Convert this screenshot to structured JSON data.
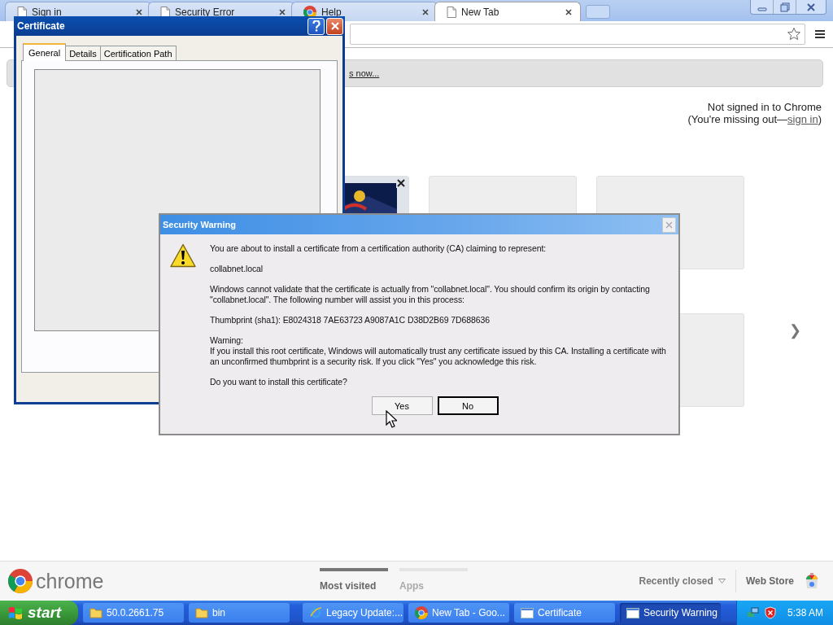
{
  "browser": {
    "tabs": [
      {
        "title": "Sign in",
        "kind": "page",
        "selected": false
      },
      {
        "title": "Security Error",
        "kind": "page",
        "selected": false
      },
      {
        "title": "Help",
        "kind": "chrome",
        "selected": false
      },
      {
        "title": "New Tab",
        "kind": "page",
        "selected": true
      }
    ],
    "infobar_link": "s now...",
    "signin": {
      "line1": "Not signed in to Chrome",
      "prefix": "(You're missing out—",
      "link": "sign in",
      "suffix": ")"
    },
    "thumbnails": [
      {
        "kind": "picture"
      },
      {
        "kind": "blank"
      },
      {
        "kind": "blank"
      },
      {
        "kind": "blank"
      }
    ],
    "next_arrow": "❯",
    "footer": {
      "logo": "chrome",
      "sections": [
        {
          "label": "Most visited",
          "selected": true
        },
        {
          "label": "Apps",
          "selected": false
        }
      ],
      "recently_closed": "Recently closed",
      "web_store": "Web Store"
    }
  },
  "certificate_window": {
    "title": "Certificate",
    "tabs": [
      {
        "label": "General",
        "selected": true
      },
      {
        "label": "Details",
        "selected": false
      },
      {
        "label": "Certification Path",
        "selected": false
      }
    ]
  },
  "security_warning": {
    "title": "Security Warning",
    "intro": "You are about to install a certificate from a certification authority (CA) claiming to represent:",
    "name": "collabnet.local",
    "validate": "Windows cannot validate that the certificate is actually from \"collabnet.local\". You should confirm its origin by contacting \"collabnet.local\". The following number will assist you in this process:",
    "thumbprint": "Thumbprint (sha1): E8024318 7AE63723 A9087A1C D38D2B69 7D688636",
    "warning_heading": "Warning:",
    "warning_text": "If you install this root certificate, Windows will automatically trust any certificate issued by this CA. Installing a certificate with an unconfirmed thumbprint is a security risk. If you click \"Yes\" you acknowledge this risk.",
    "question": "Do you want to install this certificate?",
    "buttons": [
      {
        "label": "Yes",
        "default": false
      },
      {
        "label": "No",
        "default": true
      }
    ]
  },
  "taskbar": {
    "start": "start",
    "tasks": [
      {
        "label": "50.0.2661.75",
        "kind": "folder",
        "selected": false
      },
      {
        "label": "bin",
        "kind": "folder",
        "selected": false
      },
      {
        "label": "Legacy Update:...",
        "kind": "ie",
        "selected": false
      },
      {
        "label": "New Tab - Goo...",
        "kind": "chrome",
        "selected": false
      },
      {
        "label": "Certificate",
        "kind": "window",
        "selected": false
      },
      {
        "label": "Security Warning",
        "kind": "window",
        "selected": true
      }
    ],
    "clock": "5:38 AM"
  }
}
